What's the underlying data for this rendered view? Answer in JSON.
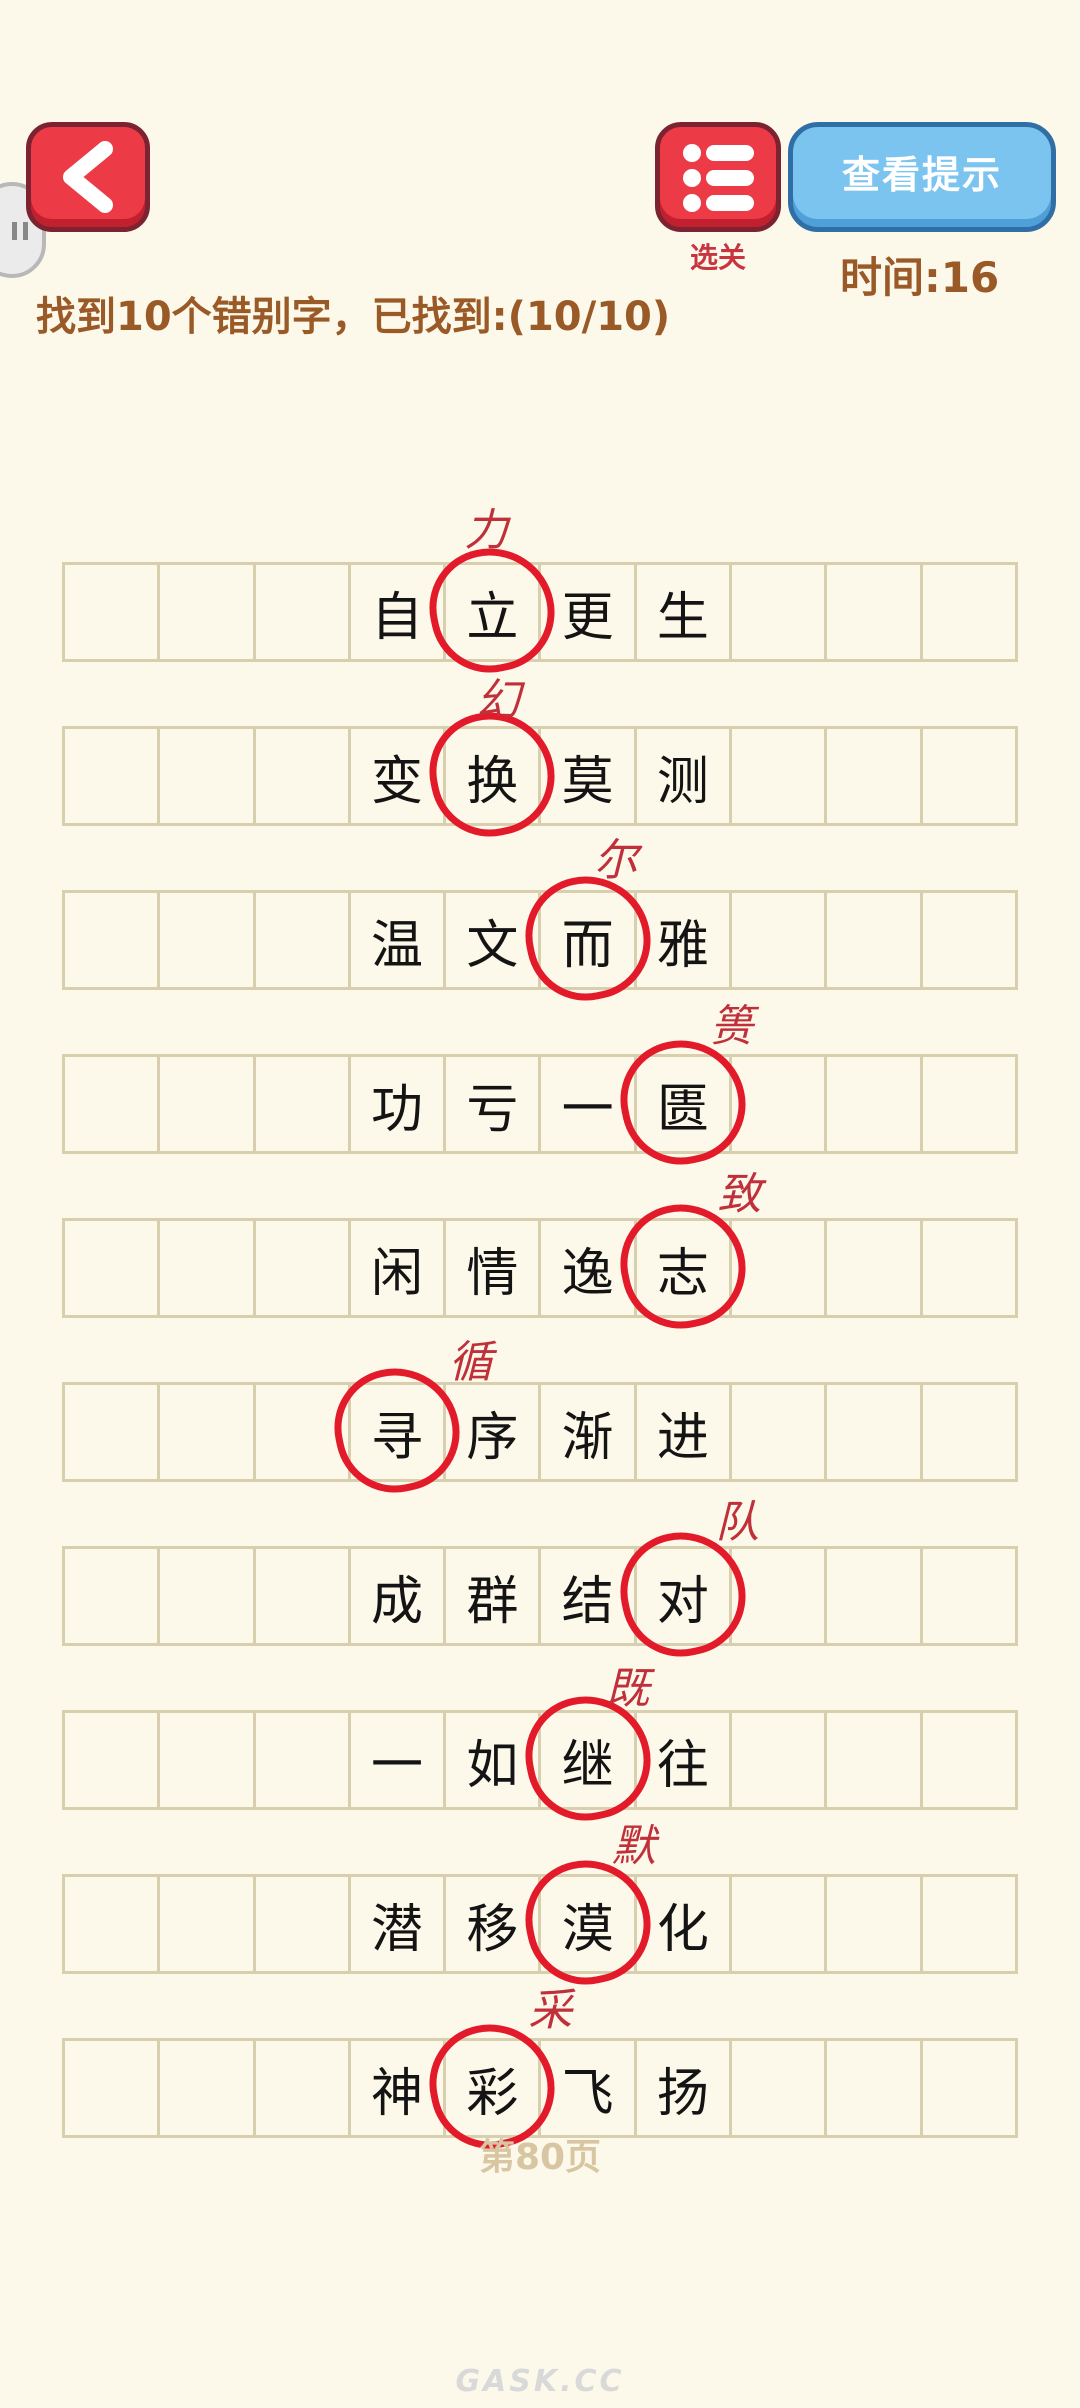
{
  "header": {
    "menu_label": "选关",
    "hint_label": "查看提示",
    "timer": "时间:16",
    "status": "找到10个错别字，已找到:(10/10)"
  },
  "icons": {
    "back": "chevron-left-icon",
    "menu": "list-icon",
    "side": "pause-icon"
  },
  "colors": {
    "background": "#fdf9ea",
    "accent_red": "#ec3b46",
    "hint_blue": "#7cc4f0",
    "circle": "#e21a2a",
    "text_brown": "#9a5a28"
  },
  "rows": [
    {
      "chars": [
        "",
        "",
        "",
        "自",
        "立",
        "更",
        "生",
        "",
        "",
        ""
      ],
      "wrong_index": 4,
      "correction": "力"
    },
    {
      "chars": [
        "",
        "",
        "",
        "变",
        "换",
        "莫",
        "测",
        "",
        "",
        ""
      ],
      "wrong_index": 4,
      "correction": "幻"
    },
    {
      "chars": [
        "",
        "",
        "",
        "温",
        "文",
        "而",
        "雅",
        "",
        "",
        ""
      ],
      "wrong_index": 5,
      "correction": "尔"
    },
    {
      "chars": [
        "",
        "",
        "",
        "功",
        "亏",
        "一",
        "匮",
        "",
        "",
        ""
      ],
      "wrong_index": 6,
      "correction": "篑"
    },
    {
      "chars": [
        "",
        "",
        "",
        "闲",
        "情",
        "逸",
        "志",
        "",
        "",
        ""
      ],
      "wrong_index": 6,
      "correction": "致"
    },
    {
      "chars": [
        "",
        "",
        "",
        "寻",
        "序",
        "渐",
        "进",
        "",
        "",
        ""
      ],
      "wrong_index": 3,
      "correction": "循"
    },
    {
      "chars": [
        "",
        "",
        "",
        "成",
        "群",
        "结",
        "对",
        "",
        "",
        ""
      ],
      "wrong_index": 6,
      "correction": "队"
    },
    {
      "chars": [
        "",
        "",
        "",
        "一",
        "如",
        "继",
        "往",
        "",
        "",
        ""
      ],
      "wrong_index": 5,
      "correction": "既"
    },
    {
      "chars": [
        "",
        "",
        "",
        "潜",
        "移",
        "漠",
        "化",
        "",
        "",
        ""
      ],
      "wrong_index": 5,
      "correction": "默"
    },
    {
      "chars": [
        "",
        "",
        "",
        "神",
        "彩",
        "飞",
        "扬",
        "",
        "",
        ""
      ],
      "wrong_index": 4,
      "correction": "采"
    }
  ],
  "page": "第80页",
  "watermark": "GASK.CC"
}
